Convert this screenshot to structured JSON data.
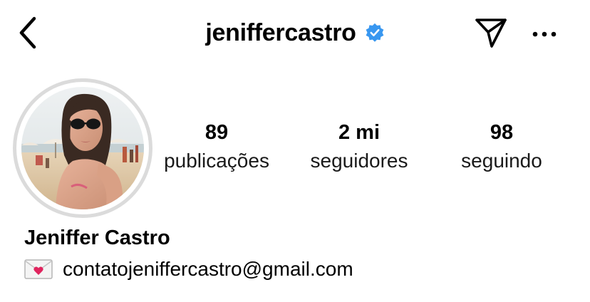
{
  "header": {
    "username": "jeniffercastro",
    "verified": true,
    "back_icon": "chevron-left-icon",
    "send_icon": "paper-plane-icon",
    "more_icon": "more-horizontal-icon",
    "verified_color": "#3897f0"
  },
  "profile": {
    "avatar_description": "profile photo on beach",
    "stats": [
      {
        "value": "89",
        "label": "publicações"
      },
      {
        "value": "2 mi",
        "label": "seguidores"
      },
      {
        "value": "98",
        "label": "seguindo"
      }
    ],
    "full_name": "Jeniffer Castro",
    "email_icon": "love-letter-emoji",
    "email": "contatojeniffercastro@gmail.com"
  }
}
